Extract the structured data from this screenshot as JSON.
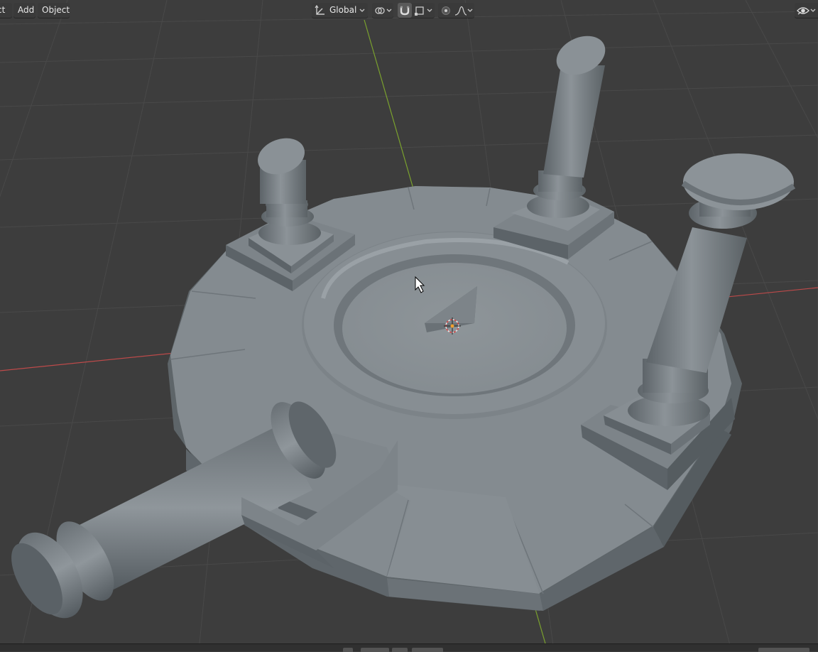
{
  "header": {
    "select_menu_partial": "ct",
    "add_menu": "Add",
    "object_menu": "Object",
    "transform_orientation": "Global"
  },
  "icons": {
    "orientation": "transform-orientation-icon",
    "pivot": "pivot-point-icon",
    "snap": "snap-magnet-icon",
    "snap_target": "snap-target-icon",
    "proportional": "proportional-editing-icon",
    "falloff": "falloff-curve-icon",
    "visibility": "object-visibility-eye-icon",
    "cursor": "mouse-pointer-icon",
    "origin": "3d-cursor-icon"
  },
  "colors": {
    "viewport_bg": "#3d3d3d",
    "grid": "#494949",
    "x_axis": "#bd4a4a",
    "y_axis": "#7aa12e",
    "mesh": "#8b9297",
    "active_toggle": "#5a5a5a"
  }
}
